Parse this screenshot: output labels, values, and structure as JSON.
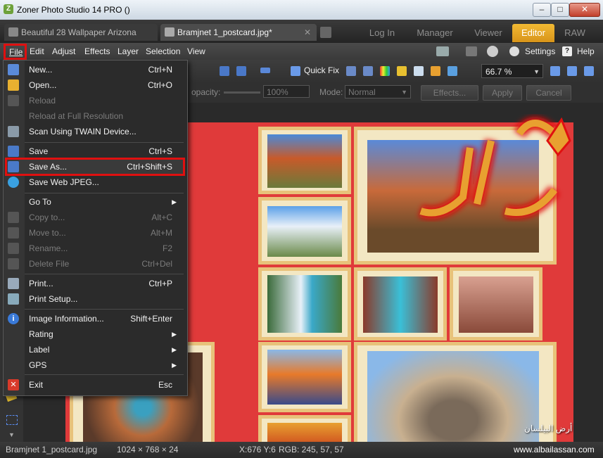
{
  "window": {
    "title": "Zoner Photo Studio 14 PRO  ()",
    "minimize": "–",
    "maximize": "□",
    "close": "✕"
  },
  "doc_tabs": [
    {
      "label": "Beautiful 28 Wallpaper Arizona"
    },
    {
      "label": "Bramjnet  1_postcard.jpg*",
      "close": "✕"
    }
  ],
  "mode_tabs": [
    {
      "label": "Log In"
    },
    {
      "label": "Manager"
    },
    {
      "label": "Viewer"
    },
    {
      "label": "Editor"
    },
    {
      "label": "RAW"
    }
  ],
  "menubar": [
    "File",
    "Edit",
    "Adjust",
    "Effects",
    "Layer",
    "Selection",
    "View"
  ],
  "menubar_right": {
    "settings": "Settings",
    "help": "Help"
  },
  "toolbar": {
    "quick_fix": "Quick Fix",
    "zoom": "66.7 %"
  },
  "toolbar2": {
    "opacity_label": "opacity:",
    "opacity_value": "100%",
    "mode_label": "Mode:",
    "mode_value": "Normal",
    "effects": "Effects...",
    "apply": "Apply",
    "cancel": "Cancel"
  },
  "file_menu": [
    {
      "label": "New...",
      "shortcut": "Ctrl+N",
      "enabled": true
    },
    {
      "label": "Open...",
      "shortcut": "Ctrl+O",
      "enabled": true
    },
    {
      "label": "Reload",
      "shortcut": "",
      "enabled": false
    },
    {
      "label": "Reload at Full Resolution",
      "shortcut": "",
      "enabled": false
    },
    {
      "label": "Scan Using TWAIN Device...",
      "shortcut": "",
      "enabled": true
    },
    {
      "label": "Save",
      "shortcut": "Ctrl+S",
      "enabled": true
    },
    {
      "label": "Save As...",
      "shortcut": "Ctrl+Shift+S",
      "enabled": true,
      "highlighted": true
    },
    {
      "label": "Save Web JPEG...",
      "shortcut": "",
      "enabled": true
    },
    {
      "label": "Go To",
      "shortcut": "",
      "enabled": true,
      "submenu": true
    },
    {
      "label": "Copy to...",
      "shortcut": "Alt+C",
      "enabled": false
    },
    {
      "label": "Move to...",
      "shortcut": "Alt+M",
      "enabled": false
    },
    {
      "label": "Rename...",
      "shortcut": "F2",
      "enabled": false
    },
    {
      "label": "Delete File",
      "shortcut": "Ctrl+Del",
      "enabled": false
    },
    {
      "label": "Print...",
      "shortcut": "Ctrl+P",
      "enabled": true
    },
    {
      "label": "Print Setup...",
      "shortcut": "",
      "enabled": true
    },
    {
      "label": "Image Information...",
      "shortcut": "Shift+Enter",
      "enabled": true
    },
    {
      "label": "Rating",
      "shortcut": "",
      "enabled": true,
      "submenu": true
    },
    {
      "label": "Label",
      "shortcut": "",
      "enabled": true,
      "submenu": true
    },
    {
      "label": "GPS",
      "shortcut": "",
      "enabled": true,
      "submenu": true
    },
    {
      "label": "Exit",
      "shortcut": "Esc",
      "enabled": true
    }
  ],
  "submenu_arrow": "▶",
  "status": {
    "filename": "Bramjnet  1_postcard.jpg",
    "size": "1024 × 768 × 24",
    "coords": "X:676 Y:6",
    "rgb": "RGB: 245, 57, 57"
  },
  "watermark": {
    "arabic": "أرض البيلسان",
    "url": "www.albailassan.com"
  },
  "colors": {
    "accent": "#e8a81c",
    "highlight": "#e01010",
    "frame": "#e8c27a",
    "postcard_border": "#e03a3a"
  }
}
